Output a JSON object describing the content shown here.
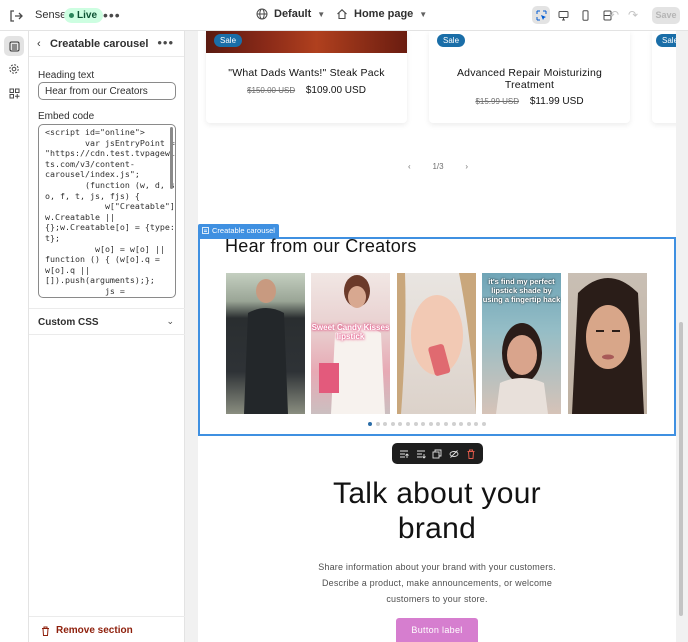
{
  "topbar": {
    "store_name": "Sense",
    "status_badge": "Live",
    "theme_label": "Default",
    "page_label": "Home page",
    "save_label": "Save"
  },
  "sidebar": {
    "section_title": "Creatable carousel",
    "heading_label": "Heading text",
    "heading_value": "Hear from our Creators",
    "embed_label": "Embed code",
    "embed_code": "<script id=\"online\">\n        var jsEntryPoint =\n\"https://cdn.test.tvpagewidge\nts.com/v3/content-\ncarousel/index.js\";\n        (function (w, d, s,\no, f, t, js, fjs) {\n            w[\"Creatable\"]=\nw.Creatable ||\n{};w.Creatable[o] = {type:\nt};\n          w[o] = w[o] ||\nfunction () { (w[o].q =\nw[o].q ||\n[]).push(arguments);};\n            js =",
    "custom_css_label": "Custom CSS",
    "remove_label": "Remove section"
  },
  "preview": {
    "products": [
      {
        "sale": "Sale",
        "name": "\"What Dads Wants!\" Steak Pack",
        "old_price": "$150.00 USD",
        "new_price": "$109.00 USD"
      },
      {
        "sale": "Sale",
        "name": "Advanced Repair Moisturizing Treatment",
        "old_price": "$15.99 USD",
        "new_price": "$11.99 USD"
      },
      {
        "sale": "Sale"
      }
    ],
    "pager": {
      "prev": "‹",
      "label": "1/3",
      "next": "›"
    },
    "section_tag": "Creatable carousel",
    "carousel_title": "Hear from our Creators",
    "tile_captions": [
      "",
      "Sweet Candy Kisses lipstick",
      "",
      "it's find my perfect lipstick shade by using a fingertip hack",
      ""
    ],
    "dot_count": 16,
    "active_dot": 0,
    "brand_heading": "Talk about your brand",
    "brand_text": "Share information about your brand with your customers. Describe a product, make announcements, or welcome customers to your store.",
    "brand_button": "Button label"
  },
  "colors": {
    "accent": "#3f90e1",
    "live_bg": "#cdfee1",
    "remove": "#8e1f0b",
    "button": "#d67ecf"
  }
}
